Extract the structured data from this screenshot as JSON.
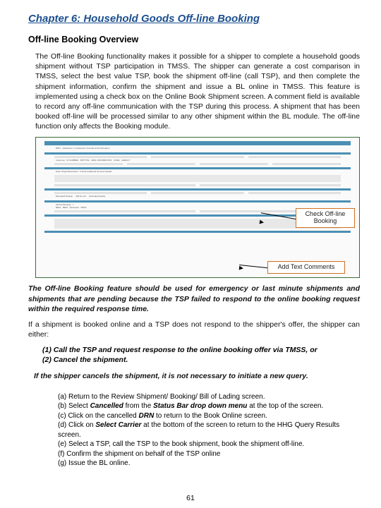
{
  "chapter": "Chapter 6:  Household Goods Off-line Booking",
  "section": "Off-line Booking Overview",
  "p1": "The Off-line Booking functionality makes it possible for a shipper to complete a household goods shipment without TSP participation in TMSS.  The shipper can generate a cost comparison in TMSS, select the best value TSP, book the shipment off-line (call TSP), and then complete the shipment information, confirm the shipment and issue a BL online in TMSS.  This feature is implemented using a check box on the Online Book Shipment screen.  A comment field is available to record any off-line communication with the TSP during this process. A shipment that has been booked off-line will be processed similar to any other shipment within the BL module.  The off-line function only affects the Booking module.",
  "callout1": "Check Off-line Booking",
  "callout2": "Add Text Comments",
  "p2": "The Off-line Booking feature should be used for emergency or last minute shipments and shipments that are pending because the TSP failed to respond to the online booking request within the required response time.",
  "p3": "If a shipment is booked online and a TSP does not respond to the shipper's offer, the shipper can either:",
  "opt1": "(1)  Call the TSP and request response to the online booking offer via TMSS, or",
  "opt2": "(2)  Cancel the shipment.",
  "p4": "If the shipper cancels the shipment, it is not necessary to initiate a new query.",
  "s_a": "(a) Return to the Review Shipment/ Booking/ Bill of Lading screen.",
  "s_b_pre": "(b) Select ",
  "s_b_em": "Cancelled",
  "s_b_mid": " from the ",
  "s_b_em2": "Status Bar drop down menu",
  "s_b_post": " at the top of the screen.",
  "s_c_pre": "(c) Click on the cancelled ",
  "s_c_em": "DRN",
  "s_c_post": " to return to the Book Online screen.",
  "s_d_pre": "(d) Click on ",
  "s_d_em": "Select Carrier",
  "s_d_post": " at the bottom of the screen to return to the HHG Query Results screen.",
  "s_e": "(e) Select a TSP, call the TSP to the book shipment, book the shipment off-line.",
  "s_f": "(f)  Confirm the shipment on behalf of the TSP online",
  "s_g": "(g) Issue the BL online.",
  "pagenum": "61"
}
